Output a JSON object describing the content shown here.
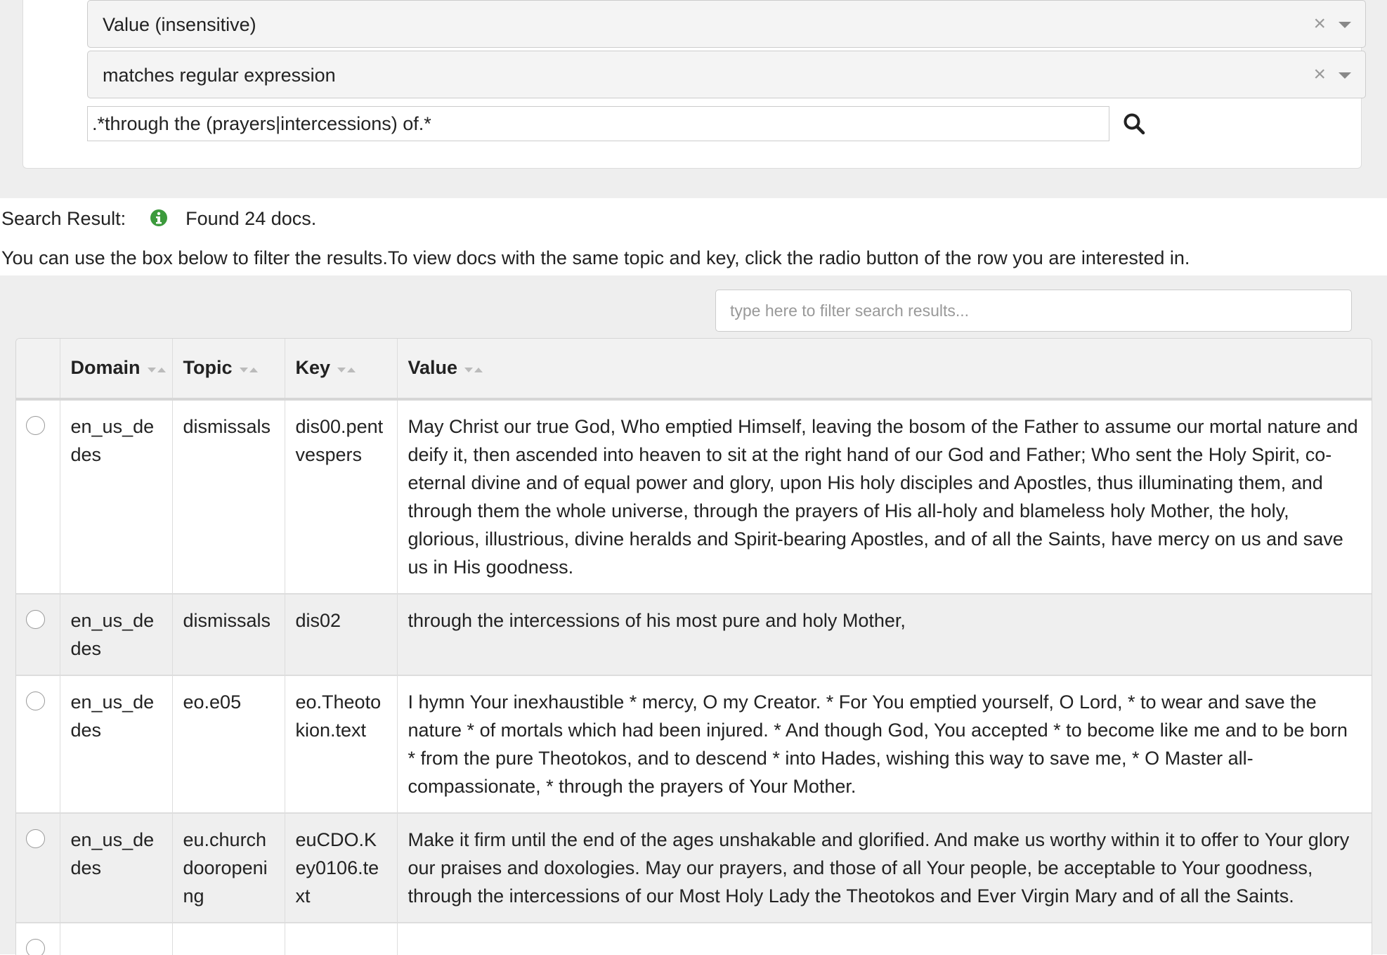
{
  "search": {
    "field_select": "Value (insensitive)",
    "operator_select": "matches regular expression",
    "query_value": ".*through the (prayers|intercessions) of.*",
    "clear_symbol": "×"
  },
  "result": {
    "label": "Search Result:",
    "found_text": "Found 24 docs.",
    "hint": "You can use the box below to filter the results.To view docs with the same topic and key, click the radio button of the row you are interested in."
  },
  "filter": {
    "placeholder": "type here to filter search results..."
  },
  "table": {
    "headers": [
      "Domain",
      "Topic",
      "Key",
      "Value"
    ],
    "rows": [
      {
        "domain": "en_us_dedes",
        "topic": "dismissals",
        "key": "dis00.pentvespers",
        "value": "May Christ our true God, Who emptied Himself, leaving the bosom of the Father to assume our mortal nature and deify it, then ascended into heaven to sit at the right hand of our God and Father; Who sent the Holy Spirit, co-eternal divine and of equal power and glory, upon His holy disciples and Apostles, thus illuminating them, and through them the whole universe, through the prayers of His all-holy and blameless holy Mother, the holy, glorious, illustrious, divine heralds and Spirit-bearing Apostles, and of all the Saints, have mercy on us and save us in His goodness."
      },
      {
        "domain": "en_us_dedes",
        "topic": "dismissals",
        "key": "dis02",
        "value": "through the intercessions of his most pure and holy Mother,"
      },
      {
        "domain": "en_us_dedes",
        "topic": "eo.e05",
        "key": "eo.Theotokion.text",
        "value": "I hymn Your inexhaustible * mercy, O my Creator. * For You emptied yourself, O Lord, * to wear and save the nature * of mortals which had been injured. * And though God, You accepted * to become like me and to be born * from the pure Theotokos, and to descend * into Hades, wishing this way to save me, * O Master all-compassionate, * through the prayers of Your Mother."
      },
      {
        "domain": "en_us_dedes",
        "topic": "eu.churchdooropening",
        "key": "euCDO.Key0106.text",
        "value": "Make it firm until the end of the ages unshakable and glorified. And make us worthy within it to offer to Your glory our praises and doxologies. May our prayers, and those of all Your people, be acceptable to Your goodness, through the intercessions of our Most Holy Lady the Theotokos and Ever Virgin Mary and of all the Saints."
      },
      {
        "domain": "",
        "topic": "",
        "key": "",
        "value": ""
      }
    ]
  },
  "colors": {
    "panel_bg": "#eeeeee",
    "info_icon": "#3c9a3c",
    "striped_row": "#efefef"
  }
}
